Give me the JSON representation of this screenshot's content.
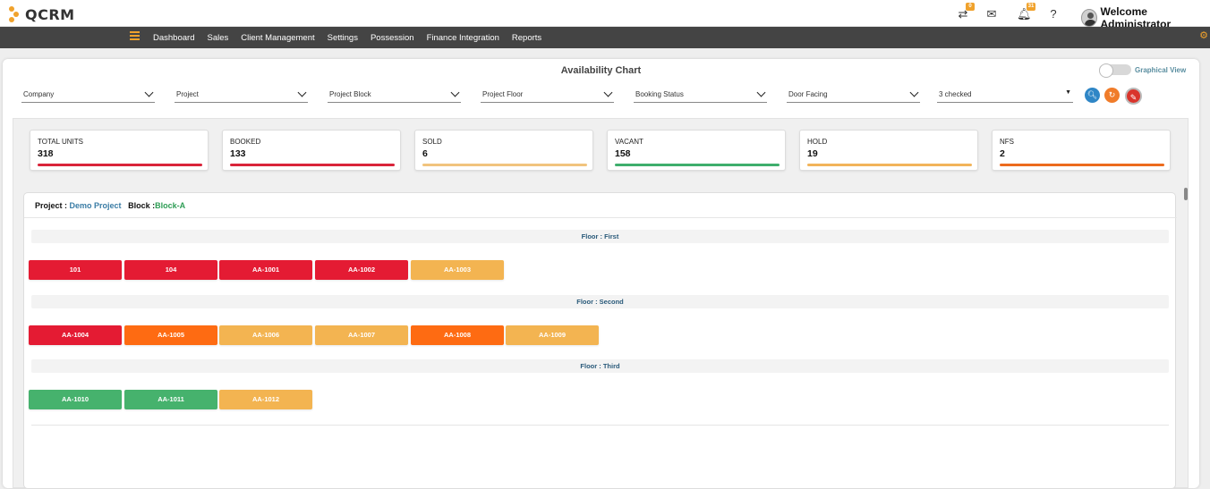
{
  "app": {
    "logo_text": "QCRM"
  },
  "topbar": {
    "icons": [
      {
        "name": "transfer-icon",
        "badge": "0"
      },
      {
        "name": "mail-icon",
        "badge": ""
      },
      {
        "name": "bell-icon",
        "badge": "31"
      },
      {
        "name": "help-icon",
        "badge": ""
      }
    ],
    "welcome": "Welcome Administrator"
  },
  "nav": {
    "items": [
      "Dashboard",
      "Sales",
      "Client Management",
      "Settings",
      "Possession",
      "Finance Integration",
      "Reports"
    ]
  },
  "page": {
    "title": "Availability Chart",
    "toggle_label": "Graphical View"
  },
  "filters": [
    {
      "label": "Company"
    },
    {
      "label": "Project"
    },
    {
      "label": "Project Block"
    },
    {
      "label": "Project Floor"
    },
    {
      "label": "Booking Status"
    },
    {
      "label": "Door Facing"
    },
    {
      "label": "3 checked"
    }
  ],
  "actions": [
    {
      "name": "search-icon",
      "color": "#2f86c6"
    },
    {
      "name": "refresh-icon",
      "color": "#f07c2a"
    },
    {
      "name": "clear-filter-icon",
      "color": "#d9342b"
    }
  ],
  "stats": [
    {
      "label": "TOTAL UNITS",
      "value": "318",
      "color": "#d9243a"
    },
    {
      "label": "BOOKED",
      "value": "133",
      "color": "#d9243a"
    },
    {
      "label": "SOLD",
      "value": "6",
      "color": "#f1c47e"
    },
    {
      "label": "VACANT",
      "value": "158",
      "color": "#3fae6d"
    },
    {
      "label": "HOLD",
      "value": "19",
      "color": "#f2b45a"
    },
    {
      "label": "NFS",
      "value": "2",
      "color": "#ec6b1e"
    }
  ],
  "project": {
    "project_label": "Project :",
    "project_name": "Demo Project",
    "block_label": "Block :",
    "block_name": "Block-A"
  },
  "status_colors": {
    "booked": "#e41b33",
    "hold": "#f3b451",
    "nfs": "#fe6b12",
    "vacant": "#46b26d"
  },
  "floors": [
    {
      "label": "Floor : First",
      "units": [
        {
          "label": "101",
          "status": "booked"
        },
        {
          "label": "104",
          "status": "booked"
        },
        {
          "label": "AA-1001",
          "status": "booked"
        },
        {
          "label": "AA-1002",
          "status": "booked"
        },
        {
          "label": "AA-1003",
          "status": "hold"
        }
      ]
    },
    {
      "label": "Floor : Second",
      "units": [
        {
          "label": "AA-1004",
          "status": "booked"
        },
        {
          "label": "AA-1005",
          "status": "nfs"
        },
        {
          "label": "AA-1006",
          "status": "hold"
        },
        {
          "label": "AA-1007",
          "status": "hold"
        },
        {
          "label": "AA-1008",
          "status": "nfs"
        },
        {
          "label": "AA-1009",
          "status": "hold"
        }
      ]
    },
    {
      "label": "Floor : Third",
      "units": [
        {
          "label": "AA-1010",
          "status": "vacant"
        },
        {
          "label": "AA-1011",
          "status": "vacant"
        },
        {
          "label": "AA-1012",
          "status": "hold"
        }
      ]
    }
  ]
}
